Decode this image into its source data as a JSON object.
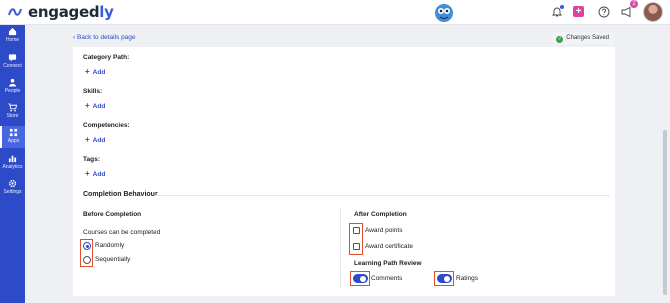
{
  "app": {
    "brand_main": "engaged",
    "brand_accent": "ly",
    "accent_color": "#2d4ac8",
    "highlight_color": "#e04f2c"
  },
  "header": {
    "notification_count": "2"
  },
  "sidebar": {
    "items": [
      {
        "label": "Home",
        "icon": "home-icon"
      },
      {
        "label": "Connect",
        "icon": "connect-icon"
      },
      {
        "label": "People",
        "icon": "people-icon"
      },
      {
        "label": "Store",
        "icon": "cart-icon"
      },
      {
        "label": "Apps",
        "icon": "apps-icon",
        "active": true
      },
      {
        "label": "Analytics",
        "icon": "analytics-icon"
      },
      {
        "label": "Settings",
        "icon": "gear-icon"
      }
    ]
  },
  "subbar": {
    "back_label": "Back to details page",
    "status_label": "Changes Saved"
  },
  "fields": {
    "category_path": {
      "label": "Category Path:",
      "add_label": "Add"
    },
    "skills": {
      "label": "Skills:",
      "add_label": "Add"
    },
    "competencies": {
      "label": "Competencies:",
      "add_label": "Add"
    },
    "tags": {
      "label": "Tags:",
      "add_label": "Add"
    }
  },
  "completion": {
    "title": "Completion Behaviour",
    "before": {
      "title": "Before Completion",
      "question": "Courses can be completed",
      "options": [
        {
          "label": "Randomly",
          "selected": true
        },
        {
          "label": "Sequentially",
          "selected": false
        }
      ]
    },
    "after": {
      "title": "After Completion",
      "checkboxes": [
        {
          "label": "Award points",
          "checked": false
        },
        {
          "label": "Award certificate",
          "checked": false
        }
      ],
      "review_title": "Learning Path Review",
      "toggles": [
        {
          "label": "Comments",
          "on": true
        },
        {
          "label": "Ratings",
          "on": true
        }
      ]
    }
  }
}
